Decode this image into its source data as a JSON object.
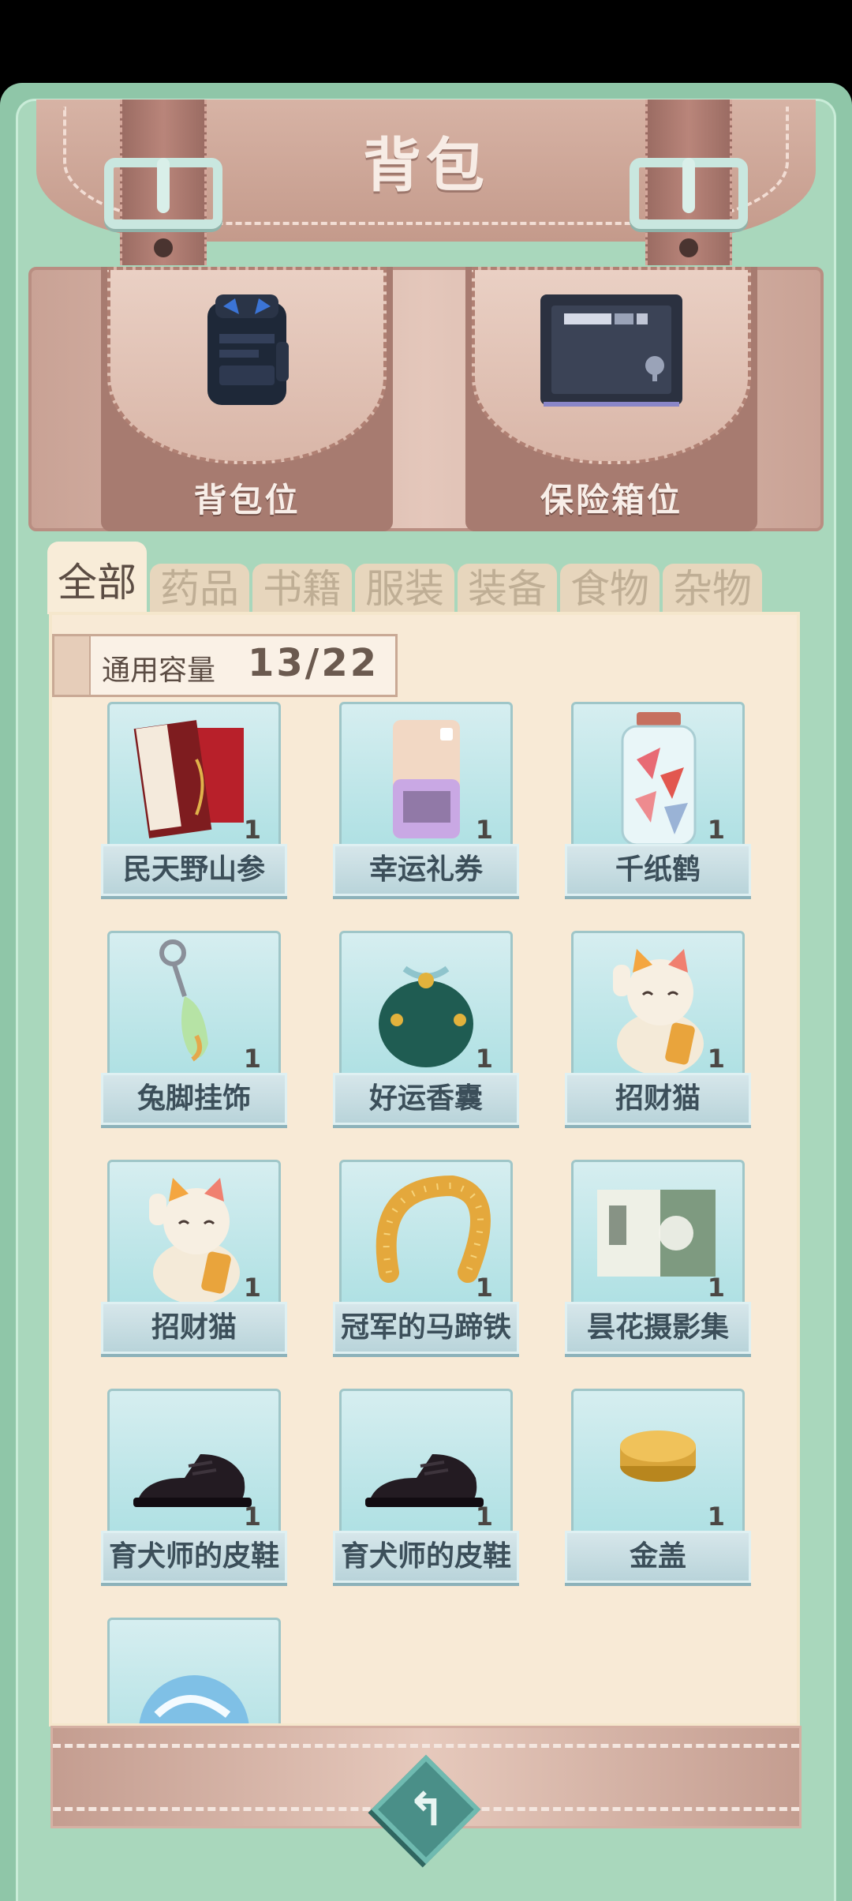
{
  "title": "背包",
  "pockets": [
    {
      "label": "背包位",
      "icon": "backpack-icon"
    },
    {
      "label": "保险箱位",
      "icon": "safe-icon"
    }
  ],
  "tabs": [
    "全部",
    "药品",
    "书籍",
    "服装",
    "装备",
    "食物",
    "杂物"
  ],
  "active_tab": "全部",
  "capacity": {
    "label": "通用容量",
    "value": "13/22"
  },
  "items": [
    {
      "name": "民天野山参",
      "count": "1",
      "icon": "ginseng-box-icon"
    },
    {
      "name": "幸运礼券",
      "count": "1",
      "icon": "ticket-icon"
    },
    {
      "name": "千纸鹤",
      "count": "1",
      "icon": "paper-crane-jar-icon"
    },
    {
      "name": "兔脚挂饰",
      "count": "1",
      "icon": "rabbit-foot-icon"
    },
    {
      "name": "好运香囊",
      "count": "1",
      "icon": "sachet-icon"
    },
    {
      "name": "招财猫",
      "count": "1",
      "icon": "lucky-cat-icon"
    },
    {
      "name": "招财猫",
      "count": "1",
      "icon": "lucky-cat-icon"
    },
    {
      "name": "冠军的马蹄铁",
      "count": "1",
      "icon": "horseshoe-icon"
    },
    {
      "name": "昙花摄影集",
      "count": "1",
      "icon": "photo-album-icon"
    },
    {
      "name": "育犬师的皮鞋",
      "count": "1",
      "icon": "leather-shoe-icon"
    },
    {
      "name": "育犬师的皮鞋",
      "count": "1",
      "icon": "leather-shoe-icon"
    },
    {
      "name": "金盖",
      "count": "1",
      "icon": "golden-lid-icon"
    },
    {
      "name": "",
      "count": "",
      "icon": "marble-icon"
    }
  ],
  "colors": {
    "tab_active_text": "#5b4c43",
    "tab_inactive_text": "#bfae95",
    "frame": "#8fc6a8"
  }
}
